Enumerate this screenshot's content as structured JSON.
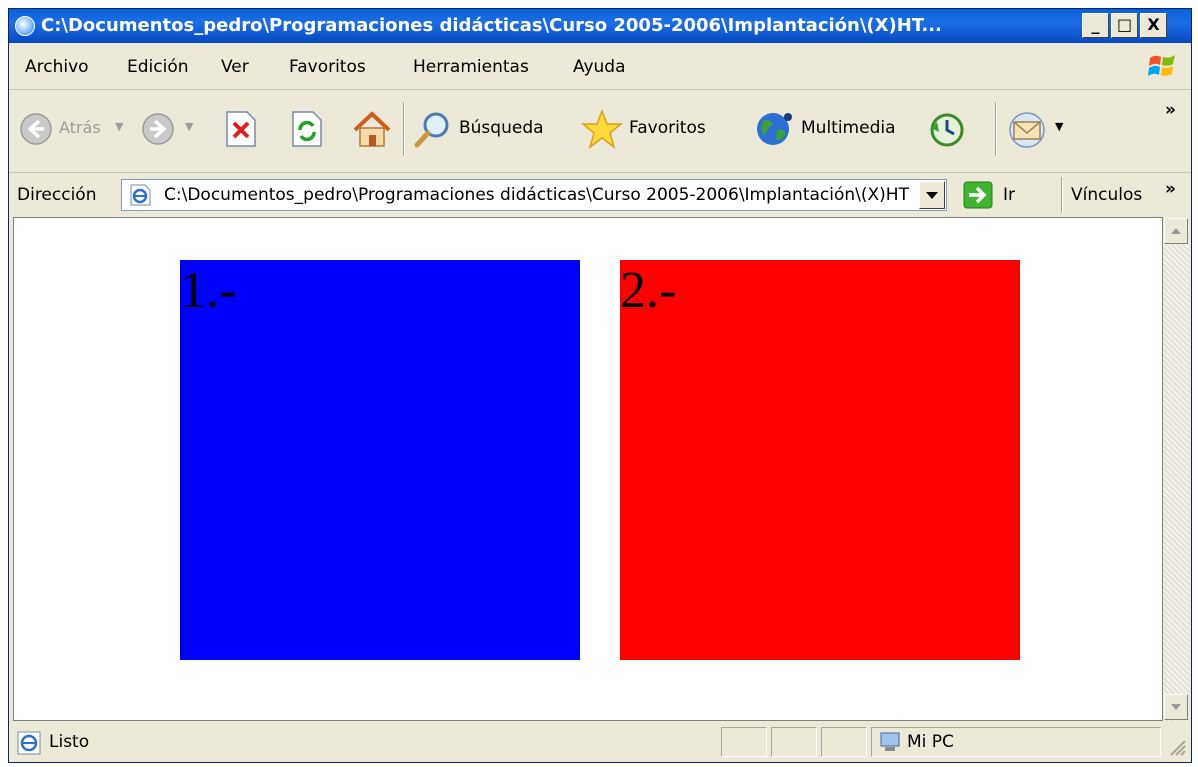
{
  "window": {
    "title": "C:\\Documentos_pedro\\Programaciones didácticas\\Curso 2005-2006\\Implantación\\(X)HT...",
    "controls": {
      "minimize": "_",
      "maximize": "□",
      "close": "X"
    }
  },
  "menubar": {
    "items": [
      {
        "label": "Archivo"
      },
      {
        "label": "Edición"
      },
      {
        "label": "Ver"
      },
      {
        "label": "Favoritos"
      },
      {
        "label": "Herramientas"
      },
      {
        "label": "Ayuda"
      }
    ]
  },
  "toolbar": {
    "back_label": "Atrás",
    "search_label": "Búsqueda",
    "favorites_label": "Favoritos",
    "multimedia_label": "Multimedia",
    "more_glyph": "»"
  },
  "addressbar": {
    "label": "Dirección",
    "url": "C:\\Documentos_pedro\\Programaciones didácticas\\Curso 2005-2006\\Implantación\\(X)HT",
    "go_label": "Ir",
    "links_label": "Vínculos",
    "more_glyph": "»"
  },
  "content": {
    "boxes": [
      {
        "label": "1.-",
        "color": "#0000ff"
      },
      {
        "label": "2.-",
        "color": "#ff0000"
      }
    ]
  },
  "statusbar": {
    "status": "Listo",
    "zone": "Mi PC"
  },
  "colors": {
    "titlebar": "#0a5fd8",
    "chrome": "#ece9d8"
  }
}
